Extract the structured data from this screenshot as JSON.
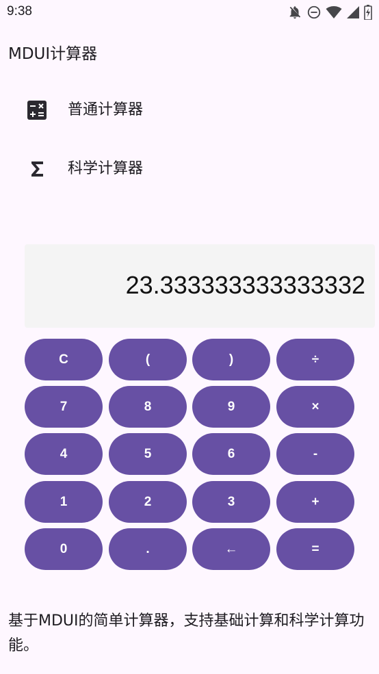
{
  "status_bar": {
    "time": "9:38",
    "icons": [
      "bell-off-icon",
      "do-not-disturb-icon",
      "wifi-icon",
      "cell-signal-icon",
      "battery-charging-icon"
    ]
  },
  "app": {
    "title": "MDUI计算器"
  },
  "nav": {
    "items": [
      {
        "label": "普通计算器",
        "icon": "calculator-icon"
      },
      {
        "label": "科学计算器",
        "icon": "sigma-icon"
      }
    ]
  },
  "display": {
    "value": "23.333333333333332"
  },
  "keypad": {
    "rows": [
      [
        "C",
        "(",
        ")",
        "÷"
      ],
      [
        "7",
        "8",
        "9",
        "×"
      ],
      [
        "4",
        "5",
        "6",
        "-"
      ],
      [
        "1",
        "2",
        "3",
        "+"
      ],
      [
        "0",
        ".",
        "←",
        "="
      ]
    ]
  },
  "colors": {
    "accent": "#6750a4",
    "background": "#fef7ff",
    "display_background": "#f4f4f4"
  },
  "description": "基于MDUI的简单计算器，支持基础计算和科学计算功能。"
}
